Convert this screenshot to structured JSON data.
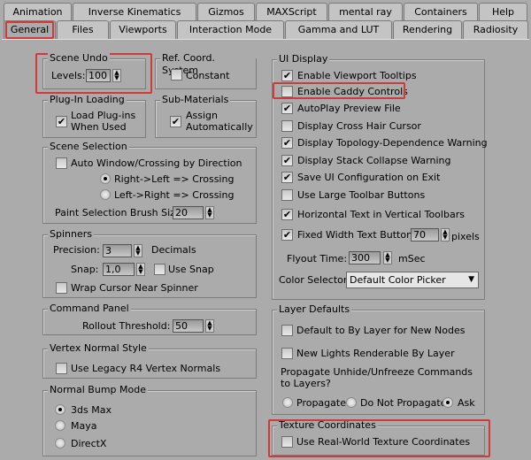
{
  "tabs_row1": [
    "Animation",
    "Inverse Kinematics",
    "Gizmos",
    "MAXScript",
    "mental ray",
    "Containers",
    "Help"
  ],
  "tabs_row2": [
    "General",
    "Files",
    "Viewports",
    "Interaction Mode",
    "Gamma and LUT",
    "Rendering",
    "Radiosity"
  ],
  "active_tab": "General",
  "highlight_color": "#d23a3a",
  "scene_undo": {
    "title": "Scene Undo",
    "levels_label": "Levels:",
    "levels_value": "100"
  },
  "ref_coord": {
    "title": "Ref. Coord. System",
    "constant": "Constant",
    "constant_checked": false
  },
  "plugin_loading": {
    "title": "Plug-In Loading",
    "line1": "Load Plug-ins",
    "line2": "When Used",
    "checked": true
  },
  "sub_materials": {
    "title": "Sub-Materials",
    "line1": "Assign",
    "line2": "Automatically",
    "checked": true
  },
  "scene_selection": {
    "title": "Scene Selection",
    "auto_window": "Auto Window/Crossing by Direction",
    "auto_window_checked": false,
    "right_left": "Right->Left => Crossing",
    "left_right": "Left->Right => Crossing",
    "selected": "Right->Left => Crossing",
    "brush_label": "Paint Selection Brush Size",
    "brush_value": "20"
  },
  "spinners": {
    "title": "Spinners",
    "precision_label": "Precision:",
    "precision_value": "3",
    "decimals": "Decimals",
    "snap_label": "Snap:",
    "snap_value": "1,0",
    "use_snap": "Use Snap",
    "use_snap_checked": false,
    "wrap": "Wrap Cursor Near Spinner",
    "wrap_checked": false
  },
  "command_panel": {
    "title": "Command Panel",
    "rollout_label": "Rollout Threshold:",
    "rollout_value": "50"
  },
  "vertex_normal": {
    "title": "Vertex Normal Style",
    "legacy": "Use Legacy R4 Vertex Normals",
    "checked": false
  },
  "normal_bump": {
    "title": "Normal Bump Mode",
    "options": [
      "3ds Max",
      "Maya",
      "DirectX"
    ],
    "selected": "3ds Max"
  },
  "ui_display": {
    "title": "UI Display",
    "items": [
      {
        "label": "Enable Viewport Tooltips",
        "checked": true
      },
      {
        "label": "Enable Caddy Controls",
        "checked": false
      },
      {
        "label": "AutoPlay Preview File",
        "checked": true
      },
      {
        "label": "Display Cross Hair Cursor",
        "checked": false
      },
      {
        "label": "Display Topology-Dependence Warning",
        "checked": true
      },
      {
        "label": "Display Stack Collapse Warning",
        "checked": true
      },
      {
        "label": "Save UI Configuration on Exit",
        "checked": true
      },
      {
        "label": "Use Large Toolbar Buttons",
        "checked": false
      },
      {
        "label": "Horizontal Text in Vertical Toolbars",
        "checked": true
      },
      {
        "label": "Fixed Width Text Buttons:",
        "checked": true
      }
    ],
    "fixed_width_value": "70",
    "pixels": "pixels",
    "flyout_label": "Flyout Time:",
    "flyout_value": "300",
    "msec": "mSec",
    "color_selector_label": "Color Selector:",
    "color_selector_value": "Default Color Picker"
  },
  "layer_defaults": {
    "title": "Layer Defaults",
    "default_by_layer": "Default to By Layer for New Nodes",
    "new_lights": "New Lights Renderable By Layer",
    "propagate_q1": "Propagate Unhide/Unfreeze Commands",
    "propagate_q2": "to Layers?",
    "options": [
      "Propagate",
      "Do Not Propagate",
      "Ask"
    ],
    "selected": "Ask"
  },
  "texture_coords": {
    "title": "Texture Coordinates",
    "real_world": "Use Real-World Texture Coordinates",
    "checked": false
  }
}
